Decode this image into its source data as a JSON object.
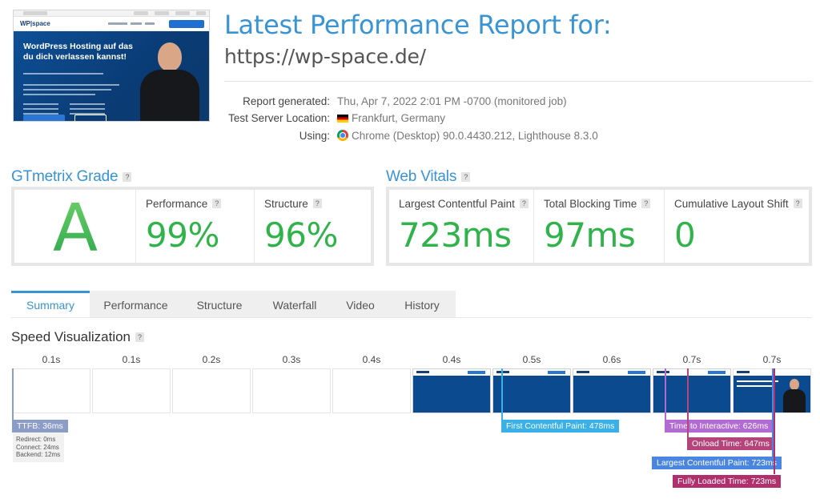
{
  "thumbnail": {
    "logo": "WP|space",
    "headline": "WordPress Hosting auf das du dich verlassen kannst!"
  },
  "report": {
    "title": "Latest Performance Report for:",
    "url": "https://wp-space.de/",
    "meta": [
      {
        "key": "Report generated:",
        "value": "Thu, Apr 7, 2022 2:01 PM -0700 (monitored job)"
      },
      {
        "key": "Test Server Location:",
        "value": "Frankfurt, Germany",
        "icon": "germany-flag-icon"
      },
      {
        "key": "Using:",
        "value": "Chrome (Desktop) 90.0.4430.212, Lighthouse 8.3.0",
        "icon": "chrome-icon"
      }
    ]
  },
  "gtmetrix": {
    "title": "GTmetrix Grade",
    "help": "?",
    "grade": "A",
    "grade_color": "#3fbf56",
    "performance_label": "Performance",
    "performance_value": "99%",
    "structure_label": "Structure",
    "structure_value": "96%"
  },
  "web_vitals": {
    "title": "Web Vitals",
    "help": "?",
    "lcp_label": "Largest Contentful Paint",
    "lcp_value": "723ms",
    "tbt_label": "Total Blocking Time",
    "tbt_value": "97ms",
    "cls_label": "Cumulative Layout Shift",
    "cls_value": "0",
    "value_color": "#2fb34a"
  },
  "tabs": [
    "Summary",
    "Performance",
    "Structure",
    "Waterfall",
    "Video",
    "History"
  ],
  "active_tab": "Summary",
  "speed_visualization": {
    "title": "Speed Visualization",
    "help": "?",
    "ticks": [
      "0.1s",
      "0.1s",
      "0.2s",
      "0.3s",
      "0.4s",
      "0.4s",
      "0.5s",
      "0.6s",
      "0.7s",
      "0.7s"
    ],
    "markers": {
      "ttfb": {
        "label": "TTFB: 36ms",
        "color": "#8b9cc6"
      },
      "ttfb_details": [
        "Redirect: 0ms",
        "Connect: 24ms",
        "Backend: 12ms"
      ],
      "fcp": {
        "label": "First Contentful Paint: 478ms",
        "color": "#3ab0e8"
      },
      "tti": {
        "label": "Time to Interactive: 626ms",
        "color": "#b26bd3"
      },
      "onload": {
        "label": "Onload Time: 647ms",
        "color": "#b5447b"
      },
      "lcp": {
        "label": "Largest Contentful Paint: 723ms",
        "color": "#4a86e0"
      },
      "fully_loaded": {
        "label": "Fully Loaded Time: 723ms",
        "color": "#b0306d"
      }
    }
  }
}
